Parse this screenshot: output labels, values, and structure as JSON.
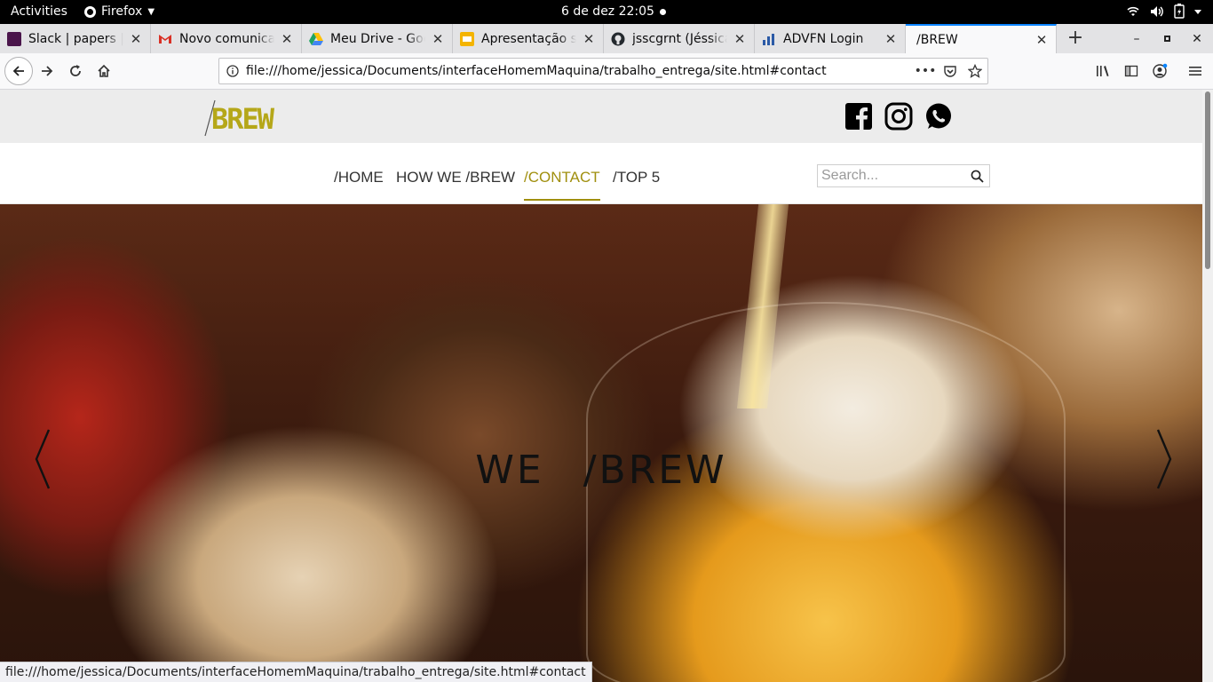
{
  "system_bar": {
    "activities": "Activities",
    "app_name": "Firefox",
    "clock": "6 de dez  22:05"
  },
  "browser": {
    "tabs": [
      {
        "title": "Slack | papers | C",
        "favicon": "slack-icon",
        "color": "#4a154b"
      },
      {
        "title": "Novo comunicad",
        "favicon": "gmail-icon",
        "color": "#d93025"
      },
      {
        "title": "Meu Drive - Goo",
        "favicon": "google-drive-icon",
        "color": "#1fa463"
      },
      {
        "title": "Apresentação se",
        "favicon": "google-slides-icon",
        "color": "#f4b400"
      },
      {
        "title": "jsscgrnt (Jéssica",
        "favicon": "github-icon",
        "color": "#24292e"
      },
      {
        "title": "ADVFN Login",
        "favicon": "advfn-icon",
        "color": "#2b5aa6"
      },
      {
        "title": "/BREW",
        "favicon": "none",
        "color": "#ffffff"
      }
    ],
    "active_tab": 6,
    "url": "file:///home/jessica/Documents/interfaceHomemMaquina/trabalho_entrega/site.html#contact",
    "status_url": "file:///home/jessica/Documents/interfaceHomemMaquina/trabalho_entrega/site.html#contact"
  },
  "site": {
    "logo_text": "BREW",
    "brand_color": "#b5a719",
    "social": [
      "facebook-icon",
      "instagram-icon",
      "whatsapp-icon"
    ],
    "nav": [
      {
        "label": "/HOME",
        "active": false
      },
      {
        "label": "HOW WE /BREW",
        "active": false
      },
      {
        "label": "/CONTACT",
        "active": true
      },
      {
        "label": "/TOP 5",
        "active": false
      }
    ],
    "search": {
      "placeholder": "Search...",
      "value": ""
    },
    "hero": {
      "slogan_left": "WE",
      "slogan_right": "/BREW"
    }
  }
}
